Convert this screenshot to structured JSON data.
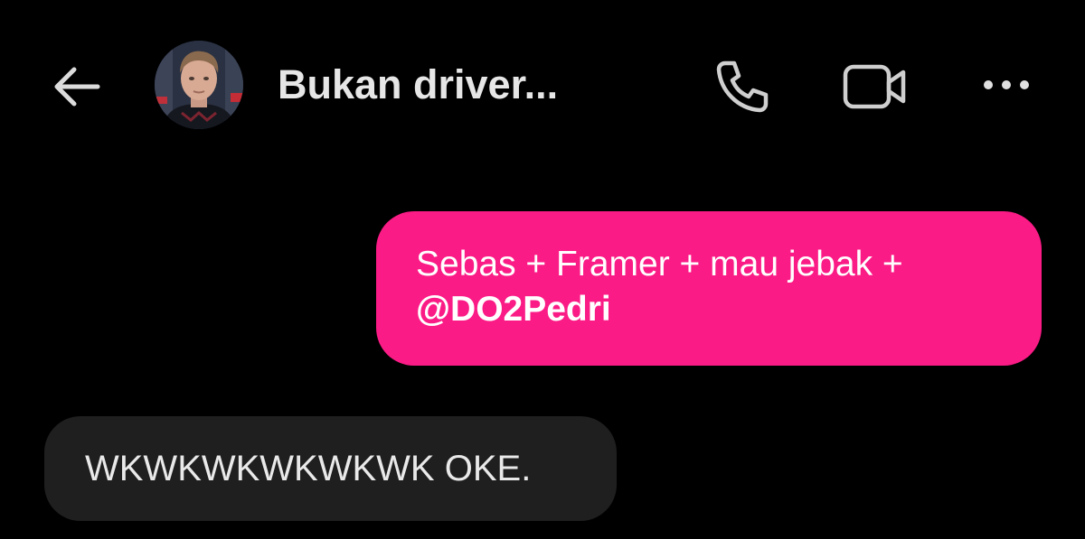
{
  "header": {
    "back_icon": "arrow-left-icon",
    "title": "Bukan driver...",
    "call_icon": "phone-icon",
    "video_icon": "video-camera-icon",
    "more_icon": "more-horizontal-icon",
    "avatar_icon": "profile-photo"
  },
  "messages": {
    "outgoing": {
      "text": "Sebas + Framer + mau jebak  +",
      "mention": "@DO2Pedri"
    },
    "incoming": {
      "text": "WKWKWKWKWKWK OKE."
    }
  },
  "colors": {
    "background": "#000000",
    "outgoing_bubble": "#fb1b86",
    "incoming_bubble": "#1f1f1f",
    "icon": "#cfcfcf"
  }
}
